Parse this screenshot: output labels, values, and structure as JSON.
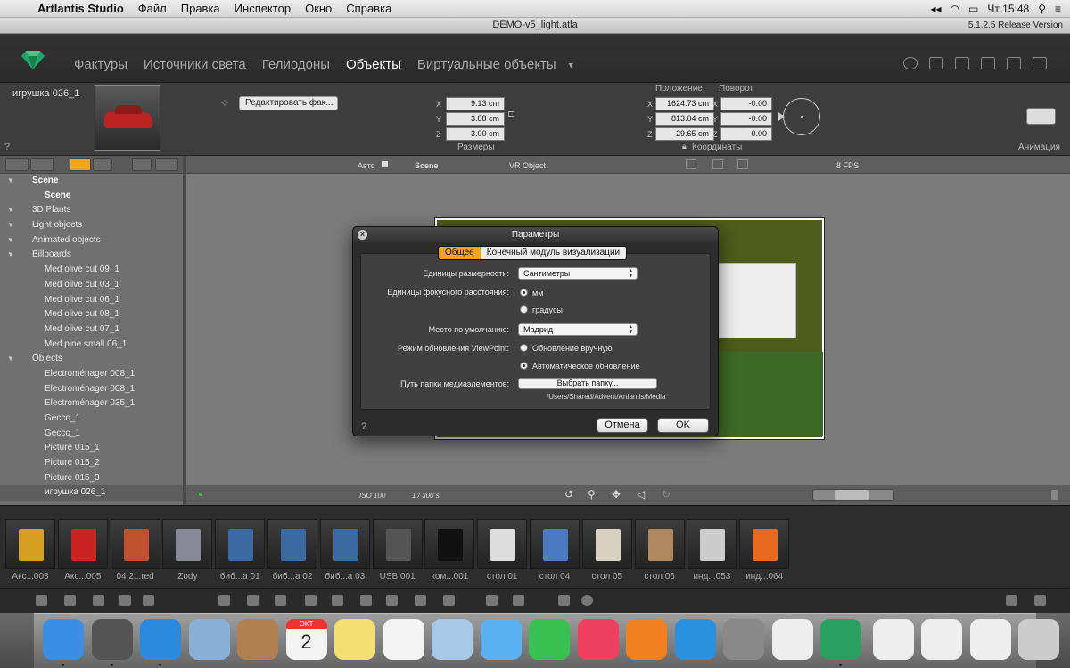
{
  "menubar": {
    "app": "Artlantis Studio",
    "items": [
      "Файл",
      "Правка",
      "Инспектор",
      "Окно",
      "Справка"
    ],
    "clock": "Чт 15:48"
  },
  "window": {
    "title": "DEMO-v5_light.atla",
    "version": "5.1.2.5 Release Version"
  },
  "tabs": [
    "Фактуры",
    "Источники света",
    "Гелиодоны",
    "Объекты",
    "Виртуальные объекты"
  ],
  "active_tab": "Объекты",
  "inspector": {
    "object_name": "игрушка 026_1",
    "help": "?",
    "edit_dropdown": "Редактировать фак...",
    "size": {
      "caption": "Размеры",
      "x_label": "X",
      "y_label": "Y",
      "z_label": "Z",
      "x": "9.13 cm",
      "y": "3.88 cm",
      "z": "3.00 cm"
    },
    "position": {
      "caption": "Положение",
      "x": "1624.73 cm",
      "y": "813.04 cm",
      "z": "29.65 cm"
    },
    "rotation": {
      "caption": "Поворот",
      "x": "-0.00",
      "y": "-0.00",
      "z": "-0.00"
    },
    "coords_caption": "Координаты",
    "animation_caption": "Анимация"
  },
  "tree": [
    {
      "label": "Scene",
      "level": 0,
      "header": true
    },
    {
      "label": "Scene",
      "level": 1,
      "header": true
    },
    {
      "label": "3D Plants",
      "level": 0
    },
    {
      "label": "Light objects",
      "level": 0
    },
    {
      "label": "Animated objects",
      "level": 0
    },
    {
      "label": "Billboards",
      "level": 0
    },
    {
      "label": "Med olive cut 09_1",
      "level": 1
    },
    {
      "label": "Med olive cut 03_1",
      "level": 1
    },
    {
      "label": "Med olive cut 06_1",
      "level": 1
    },
    {
      "label": "Med olive cut 08_1",
      "level": 1
    },
    {
      "label": "Med olive cut 07_1",
      "level": 1
    },
    {
      "label": "Med pine small 06_1",
      "level": 1
    },
    {
      "label": "Objects",
      "level": 0
    },
    {
      "label": "Electroménager 008_1",
      "level": 1
    },
    {
      "label": "Electroménager 008_1",
      "level": 1
    },
    {
      "label": "Electroménager 035_1",
      "level": 1
    },
    {
      "label": "Gecco_1",
      "level": 1
    },
    {
      "label": "Gecco_1",
      "level": 1
    },
    {
      "label": "Picture 015_1",
      "level": 1
    },
    {
      "label": "Picture 015_2",
      "level": 1
    },
    {
      "label": "Picture 015_3",
      "level": 1
    },
    {
      "label": "игрушка 026_1",
      "level": 1,
      "selected": true
    }
  ],
  "viewbar": {
    "auto": "Авто",
    "scene": "Scene",
    "vr": "VR Object",
    "fps": "8 FPS",
    "iso": "ISO 100",
    "shutter": "1 / 300 s"
  },
  "dialog": {
    "title": "Параметры",
    "tab_general": "Общее",
    "tab_render": "Конечный модуль визуализации",
    "units_label": "Единицы размерности:",
    "units_value": "Сантиметры",
    "focal_label": "Единицы фокусного расстояния:",
    "focal_mm": "мм",
    "focal_deg": "градусы",
    "place_label": "Место по умолчанию:",
    "place_value": "Мадрид",
    "update_label": "Режим обновления ViewPoint:",
    "update_manual": "Обновление вручную",
    "update_auto": "Автоматическое обновление",
    "media_label": "Путь папки медиаэлементов:",
    "media_button": "Выбрать папку...",
    "media_path": "/Users/Shared/Advent/Artlantis/Media",
    "help": "?",
    "cancel": "Отмена",
    "ok": "OK"
  },
  "library": [
    {
      "label": "Акс...003",
      "color": "#d8a020"
    },
    {
      "label": "Акс...005",
      "color": "#c22"
    },
    {
      "label": "04 2...red",
      "color": "#c05030"
    },
    {
      "label": "Zody",
      "color": "#889"
    },
    {
      "label": "биб...a 01",
      "color": "#3a6aa0"
    },
    {
      "label": "биб...a 02",
      "color": "#3a6aa0"
    },
    {
      "label": "биб...a 03",
      "color": "#3a6aa0"
    },
    {
      "label": "USB 001",
      "color": "#555"
    },
    {
      "label": "ком...001",
      "color": "#111"
    },
    {
      "label": "стол 01",
      "color": "#ddd"
    },
    {
      "label": "стол 04",
      "color": "#4a7ac0"
    },
    {
      "label": "стол 05",
      "color": "#d8d0c0"
    },
    {
      "label": "стол 06",
      "color": "#b08860"
    },
    {
      "label": "инд...053",
      "color": "#ccc"
    },
    {
      "label": "инд...064",
      "color": "#e86a20"
    }
  ],
  "dock": [
    {
      "name": "finder",
      "color": "#3a8ee6"
    },
    {
      "name": "launchpad",
      "color": "#555"
    },
    {
      "name": "safari",
      "color": "#2a8ae0"
    },
    {
      "name": "mail",
      "color": "#8ab0d8"
    },
    {
      "name": "contacts",
      "color": "#b08050"
    },
    {
      "name": "calendar",
      "color": "#f4f4f4"
    },
    {
      "name": "notes",
      "color": "#f4e070"
    },
    {
      "name": "reminders",
      "color": "#f4f4f4"
    },
    {
      "name": "preview",
      "color": "#a8c8e8"
    },
    {
      "name": "messages",
      "color": "#5ab0f0"
    },
    {
      "name": "facetime",
      "color": "#3ac050"
    },
    {
      "name": "itunes",
      "color": "#f04060"
    },
    {
      "name": "ibooks",
      "color": "#f08020"
    },
    {
      "name": "app-store",
      "color": "#2a90e0"
    },
    {
      "name": "system-preferences",
      "color": "#888"
    },
    {
      "name": "textedit",
      "color": "#eee"
    },
    {
      "name": "artlantis",
      "color": "#2aa060"
    },
    {
      "name": "zip-file",
      "color": "#eee"
    },
    {
      "name": "document",
      "color": "#eee"
    },
    {
      "name": "document-2",
      "color": "#eee"
    },
    {
      "name": "trash",
      "color": "#ccc"
    }
  ],
  "calendar": {
    "month": "ОКТ",
    "day": "2"
  }
}
